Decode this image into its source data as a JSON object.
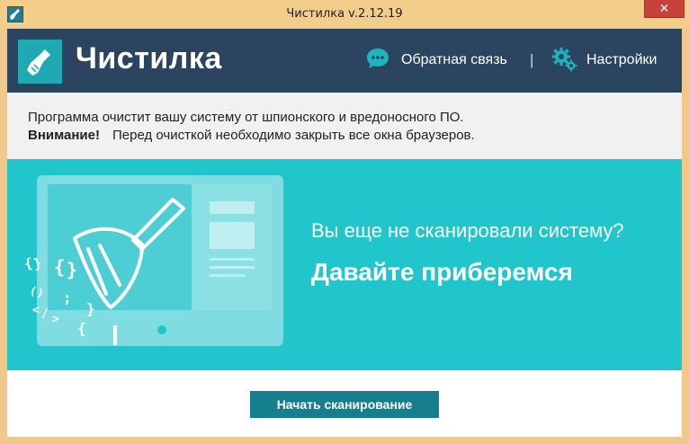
{
  "window": {
    "title": "Чистилка v.2.12.19",
    "close_glyph": "✕"
  },
  "header": {
    "app_name": "Чистилка",
    "feedback_label": "Обратная связь",
    "separator": "|",
    "settings_label": "Настройки",
    "logo_icon": "broom-icon",
    "feedback_icon": "chat-bubble-icon",
    "settings_icon": "gears-icon"
  },
  "notice": {
    "line1": "Программа очистит вашу систему от шпионского и вредоносного ПО.",
    "warning_label": "Внимание!",
    "warning_text": "Перед очисткой необходимо закрыть все окна браузеров."
  },
  "hero": {
    "question": "Вы еще не сканировали систему?",
    "call_to_action": "Давайте приберемся",
    "illustration": "monitor-with-broom-icon",
    "code_glyphs": [
      "{",
      "}",
      "{",
      "}",
      "(",
      ")",
      "<",
      "/",
      ">",
      ";",
      "}",
      "{"
    ]
  },
  "actions": {
    "scan_button": "Начать сканирование"
  },
  "colors": {
    "window_chrome": "#f3ce8b",
    "header_bg": "#2b4460",
    "accent": "#21c5cc",
    "logo_bg": "#1fa9b2",
    "button_bg": "#157f8f",
    "close_btn": "#c7423a"
  }
}
